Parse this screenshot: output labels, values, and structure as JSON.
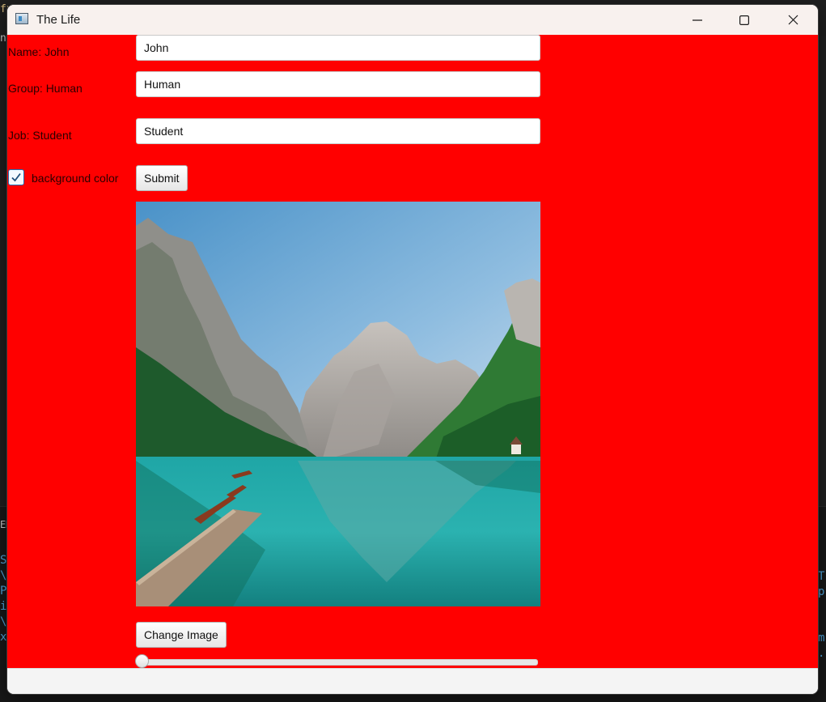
{
  "window": {
    "title": "The Life",
    "controls": {
      "minimize": "minimize-icon",
      "maximize": "maximize-icon",
      "close": "close-icon"
    }
  },
  "form": {
    "name_label": "Name: John",
    "name_value": "John",
    "group_label": "Group: Human",
    "group_value": "Human",
    "job_label": "Job: Student",
    "job_value": "Student",
    "checkbox_label": "background color",
    "checkbox_checked": true,
    "submit_label": "Submit",
    "background_color": "#ff0000"
  },
  "image": {
    "description_icon": "landscape-photo",
    "change_label": "Change Image"
  },
  "slider": {
    "value": 0.0
  },
  "ide_background": {
    "left_fragments": "S\n\\\nP\ni\n\\\nx",
    "right_fragments": "T\np\n\n\nm\n.",
    "top_fragment": "fx",
    "side_fragment": "na",
    "bottom_fragment": "EM"
  }
}
